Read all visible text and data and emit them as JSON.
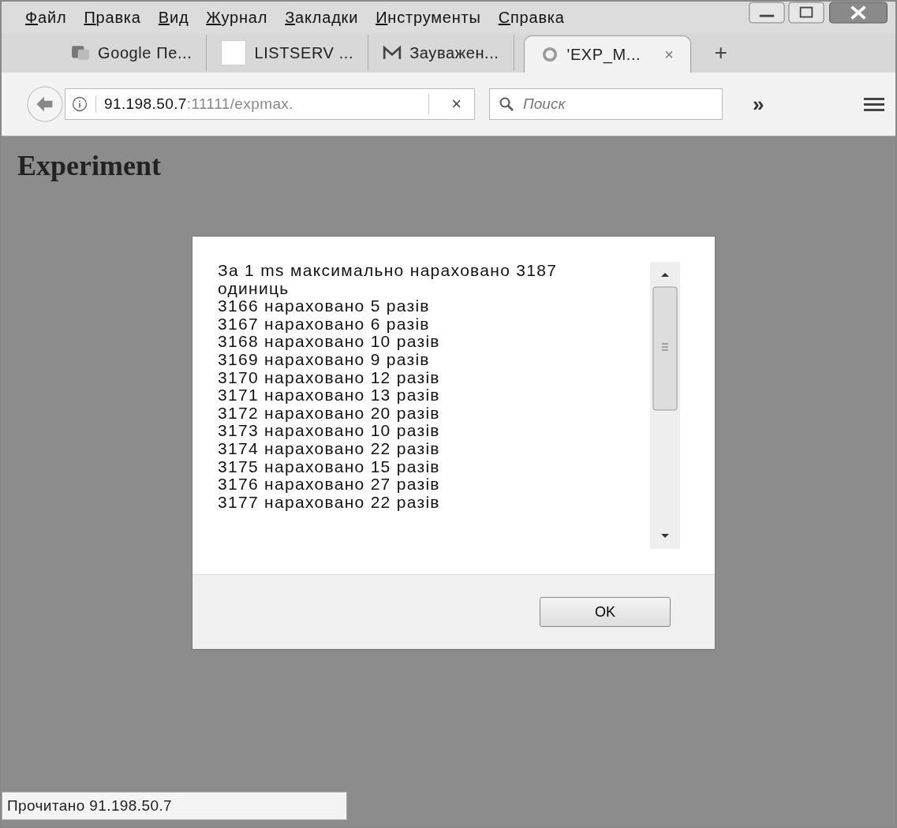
{
  "menu": [
    "Файл",
    "Правка",
    "Вид",
    "Журнал",
    "Закладки",
    "Инструменты",
    "Справка"
  ],
  "tabs": [
    {
      "label": "Google Пе...",
      "kind": "translate",
      "selected": false
    },
    {
      "label": "LISTSERV ...",
      "kind": "blank",
      "selected": false
    },
    {
      "label": "Зауважен...",
      "kind": "mail",
      "selected": false
    },
    {
      "label": "'EXP_M...",
      "kind": "loading",
      "selected": true,
      "close": "×"
    }
  ],
  "new_tab": "+",
  "address": {
    "host": "91.198.50.7",
    "path": ":11111/expmax.",
    "clear": "×"
  },
  "search": {
    "placeholder": "Поиск"
  },
  "overflow": "»",
  "page": {
    "heading": "Experiment"
  },
  "dialog": {
    "lines": [
      " За 1 ms максимально нараховано 3187 одиниць",
      "3166 нараховано 5 разів",
      "3167 нараховано 6 разів",
      "3168 нараховано 10 разів",
      "3169 нараховано 9 разів",
      "3170 нараховано 12 разів",
      "3171 нараховано 13 разів",
      "3172 нараховано 20 разів",
      "3173 нараховано 10 разів",
      "3174 нараховано 22 разів",
      "3175 нараховано 15 разів",
      "3176 нараховано 27 разів",
      "3177 нараховано 22 разів"
    ],
    "button": "OK"
  },
  "status_bar": "Прочитано 91.198.50.7"
}
